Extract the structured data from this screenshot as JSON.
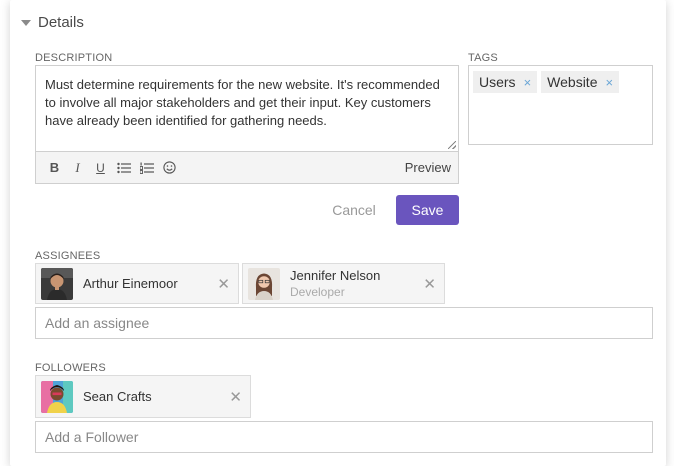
{
  "section": {
    "title": "Details"
  },
  "description": {
    "label": "DESCRIPTION",
    "text": "Must determine requirements for the new website. It's recommended to involve all major stakeholders and get their input. Key customers have already been identified for gathering needs.",
    "toolbar": {
      "bold": "B",
      "italic": "I",
      "underline": "U",
      "preview": "Preview"
    }
  },
  "tags": {
    "label": "TAGS",
    "items": [
      {
        "label": "Users"
      },
      {
        "label": "Website"
      }
    ],
    "remove_glyph": "×"
  },
  "actions": {
    "cancel": "Cancel",
    "save": "Save"
  },
  "assignees": {
    "label": "ASSIGNEES",
    "people": [
      {
        "name": "Arthur Einemoor",
        "role": ""
      },
      {
        "name": "Jennifer Nelson",
        "role": "Developer"
      }
    ],
    "placeholder": "Add an assignee"
  },
  "followers": {
    "label": "FOLLOWERS",
    "people": [
      {
        "name": "Sean Crafts"
      }
    ],
    "placeholder": "Add a Follower"
  },
  "colors": {
    "accent": "#6a55be",
    "tag_remove": "#6aa6d6"
  }
}
